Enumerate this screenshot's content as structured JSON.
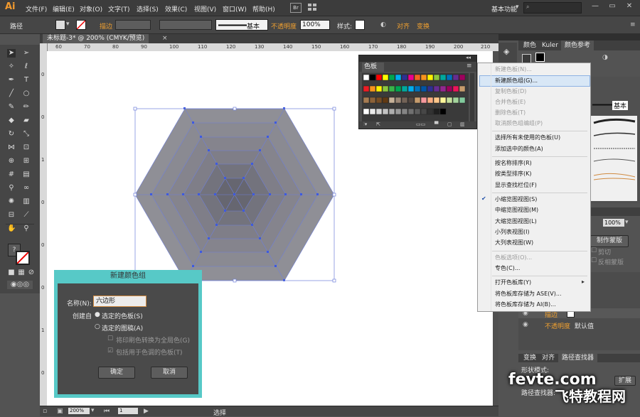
{
  "app": {
    "logo": "Ai",
    "menu": [
      "文件(F)",
      "编辑(E)",
      "对象(O)",
      "文字(T)",
      "选择(S)",
      "效果(C)",
      "视图(V)",
      "窗口(W)",
      "帮助(H)"
    ],
    "bridge": "Br",
    "workspace": "基本功能"
  },
  "control_bar": {
    "selection_label": "路径",
    "stroke_label": "描边",
    "brush_label": "基本",
    "opacity_label": "不透明度",
    "opacity_value": "100%",
    "style_label": "样式:",
    "align_label": "对齐",
    "transform_label": "变换"
  },
  "document": {
    "tab_title": "未标题-3* @ 200% (CMYK/预览)",
    "ruler_h": [
      "60",
      "70",
      "80",
      "90",
      "100",
      "110",
      "120",
      "130",
      "140",
      "150",
      "160",
      "170",
      "180",
      "190",
      "200",
      "210"
    ],
    "ruler_v": [
      "0",
      "0",
      "1",
      "0",
      "0",
      "0",
      "1",
      "0"
    ]
  },
  "status": {
    "zoom": "200%",
    "page": "1",
    "tool": "选择"
  },
  "swatches_panel": {
    "title": "色板",
    "colors": {
      "row1": [
        "#ffffff",
        "#000000",
        "#ff0000",
        "#ffff00",
        "#00a650",
        "#00aeef",
        "#2e3192",
        "#ec008c",
        "#f26522",
        "#f7941d",
        "#fff200",
        "#8dc63f",
        "#00a99d",
        "#0072bc",
        "#662d91",
        "#9e005d"
      ],
      "row2": [
        "#ed1c24",
        "#f7941d",
        "#fff200",
        "#8dc63f",
        "#39b54a",
        "#00a651",
        "#00a99d",
        "#00aeef",
        "#0072bc",
        "#0054a6",
        "#2e3192",
        "#662d91",
        "#92278f",
        "#9e005d",
        "#ed145b",
        "#c69c6d"
      ],
      "row3": [
        "#a67c52",
        "#8c6239",
        "#754c24",
        "#603913",
        "#c7b299",
        "#998675",
        "#736357",
        "#534741",
        "#c69c6d",
        "#f5989d",
        "#f9ad81",
        "#fdc68a",
        "#fff79a",
        "#c4df9b",
        "#a3d39c",
        "#82ca9d"
      ],
      "row4": [
        "#ffffff",
        "#ebebeb",
        "#d7d7d7",
        "#c2c2c2",
        "#aeaeae",
        "#999999",
        "#858585",
        "#707070",
        "#5c5c5c",
        "#474747",
        "#333333",
        "#1f1f1f",
        "#000000"
      ]
    }
  },
  "right_panel": {
    "top_tabs": [
      "颜色",
      "Kuler",
      "颜色参考"
    ],
    "mid_label": "基本",
    "transparency_value": "100%",
    "make_mask": "制作蒙版",
    "clip_label": "剪切",
    "invert_label": "反相蒙版",
    "default_label": "默认值",
    "layer_label": "描边",
    "opacity_label2": "不透明度",
    "bottom_tabs": [
      "变换",
      "对齐",
      "路径查找器"
    ],
    "shape_mode": "形状模式:",
    "pathfinder": "路径查找器:",
    "expand": "扩展"
  },
  "context_menu": {
    "items": [
      {
        "label": "新建色板(N)...",
        "disabled": true
      },
      {
        "label": "新建颜色组(G)...",
        "disabled": false,
        "highlight": true
      },
      {
        "label": "复制色板(D)",
        "disabled": true
      },
      {
        "label": "合并色板(E)",
        "disabled": true
      },
      {
        "label": "删除色板(T)",
        "disabled": true
      },
      {
        "label": "取消颜色组编组(P)",
        "disabled": true
      },
      {
        "label": "选择所有未使用的色板(U)",
        "disabled": false
      },
      {
        "label": "添加选中的颜色(A)",
        "disabled": false
      },
      {
        "label": "按名称排序(R)",
        "disabled": false
      },
      {
        "label": "按类型排序(K)",
        "disabled": false
      },
      {
        "label": "显示查找栏位(F)",
        "disabled": false
      },
      {
        "label": "小缩览图视图(S)",
        "disabled": false,
        "checked": true
      },
      {
        "label": "中缩览图视图(M)",
        "disabled": false
      },
      {
        "label": "大缩览图视图(L)",
        "disabled": false
      },
      {
        "label": "小列表视图(I)",
        "disabled": false
      },
      {
        "label": "大列表视图(W)",
        "disabled": false
      },
      {
        "label": "色板选项(O)...",
        "disabled": true
      },
      {
        "label": "专色(C)...",
        "disabled": false
      },
      {
        "label": "打开色板库(Y)",
        "disabled": false,
        "submenu": true
      },
      {
        "label": "将色板库存储为 ASE(V)...",
        "disabled": false
      },
      {
        "label": "将色板库存储为 AI(B)...",
        "disabled": false
      }
    ],
    "check_mark": "✔",
    "submenu_arrow": "▸"
  },
  "dialog": {
    "title": "新建颜色组",
    "name_label": "名称(N):",
    "name_value": "六边形",
    "create_from": "创建自",
    "opt_selected_swatches": "选定的色板(S)",
    "opt_selected_artwork": "选定的图稿(A)",
    "chk_convert_global": "将印刷色转换为全局色(G)",
    "chk_include_tints": "包括用于色调的色板(T)",
    "ok": "确定",
    "cancel": "取消"
  },
  "watermark": {
    "line1": "fevte.com",
    "line2": "飞特教程网"
  }
}
